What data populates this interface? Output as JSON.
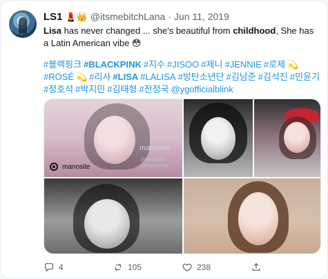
{
  "tweet": {
    "display_name": "LS1",
    "emoji": "💄👑",
    "handle": "@itsmebitchLana",
    "separator": "·",
    "date": "Jun 11, 2019",
    "text": {
      "part1": "Lisa",
      "part2": " has never changed ... she's beautiful from ",
      "part3": "childhood",
      "part4": ", She has a Latin American vibe",
      "emoji": "😳"
    },
    "hashtags": [
      "#블랙핑크",
      "#BLACKPINK",
      "#지수",
      "#JISOO",
      "#제니",
      "#JENNIE",
      "#로제",
      "💫",
      "#ROSÉ",
      "💫",
      "#리사",
      "#LISA",
      "#LALISA",
      "#방탄소년단",
      "#김남준",
      "#김석진",
      "#민윤기",
      "#정호석",
      "#박지민",
      "#김태형",
      "#전정국",
      "@ygofficialblink"
    ],
    "bold_hashtags": [
      1,
      11
    ],
    "media": {
      "watermark": "manosite",
      "watermark_sub": "Instagram @manosite",
      "credit": "manosite"
    },
    "actions": {
      "reply_count": "4",
      "retweet_count": "105",
      "like_count": "238"
    }
  },
  "colors": {
    "link": "#1b95e0",
    "muted": "#536471",
    "hat": "#c82332"
  }
}
